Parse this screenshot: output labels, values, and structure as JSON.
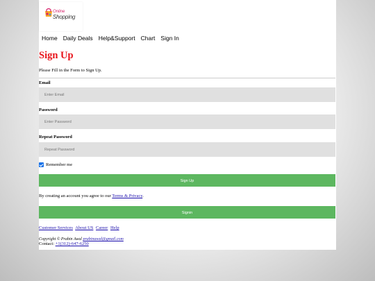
{
  "logo": {
    "line1": "Online",
    "line2": "Shopping"
  },
  "nav": [
    "Home",
    "Daily Deals",
    "Help&Support",
    "Chart",
    "Sign In"
  ],
  "form": {
    "title": "Sign Up",
    "intro": "Please Fill in the Form to Sign Up.",
    "email_label": "Email",
    "email_placeholder": "Enter Email",
    "password_label": "Password",
    "password_placeholder": "Enter Password",
    "repeat_label": "Repeat Password",
    "repeat_placeholder": "Repeat Password",
    "remember": "Remember me",
    "signup_button": "Sign Up",
    "agree_prefix": "By creating an account you agree to our ",
    "terms_link": "Terms & Privacy",
    "agree_suffix": ".",
    "signin_button": "Signin"
  },
  "footer": {
    "links": [
      "Customer Services",
      "About US",
      "Career",
      "Help"
    ],
    "copyright": "Copyright © Prabin Awal ",
    "email": "prabinawal@gmail.com",
    "contact_label": "Contact: ",
    "phone": "+1(312)-647-6250"
  },
  "colors": {
    "title": "#e8141b",
    "button": "#5db760",
    "field_bg": "#e0e0e0",
    "link": "#1a0dab"
  }
}
